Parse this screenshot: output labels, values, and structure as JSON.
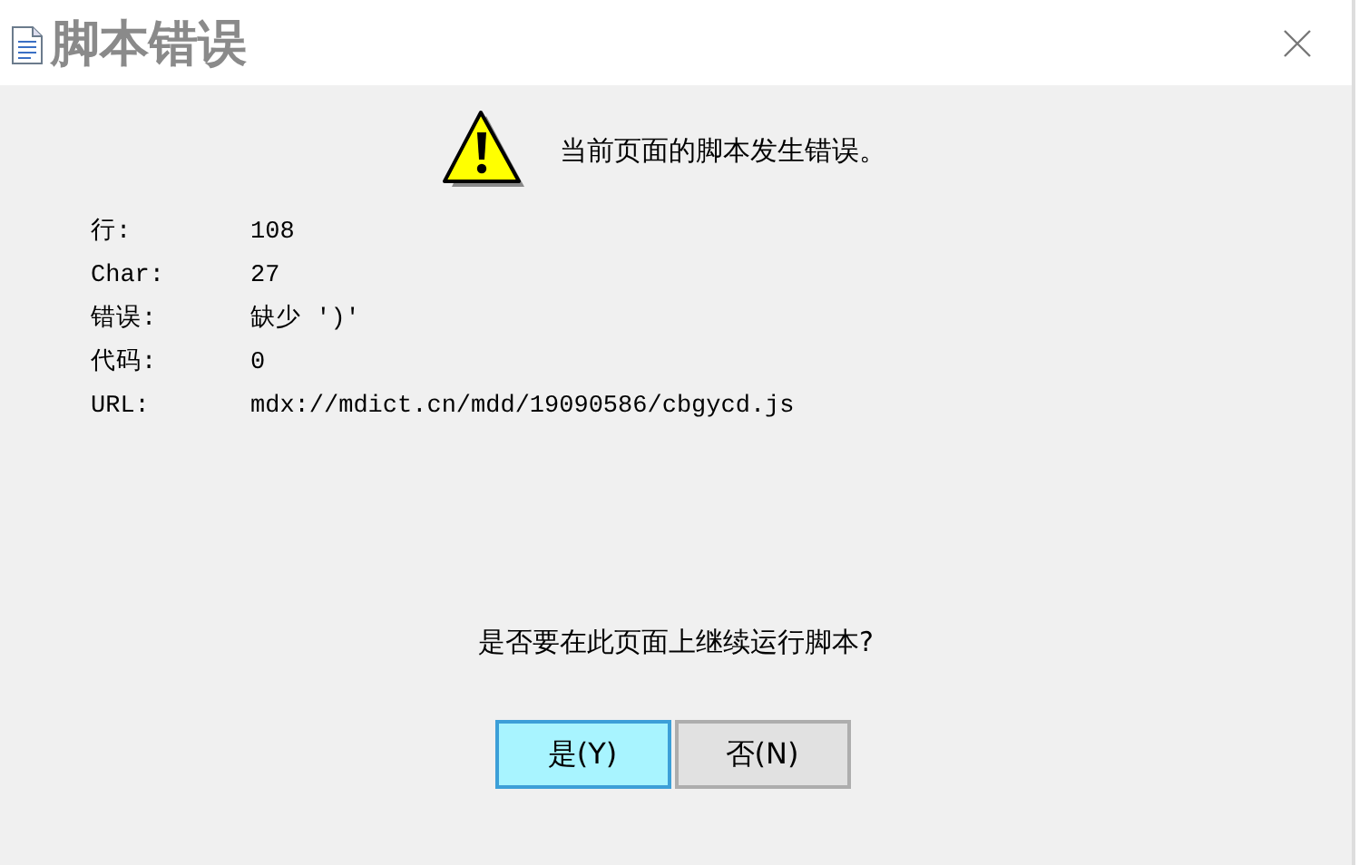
{
  "window": {
    "title": "脚本错误"
  },
  "message": "当前页面的脚本发生错误。",
  "details": [
    {
      "label": "行:",
      "value": "108"
    },
    {
      "label": "Char:",
      "value": "27"
    },
    {
      "label": "错误:",
      "value": "缺少 ')'"
    },
    {
      "label": "代码:",
      "value": "0"
    },
    {
      "label": "URL:",
      "value": "mdx://mdict.cn/mdd/19090586/cbgycd.js"
    }
  ],
  "question": "是否要在此页面上继续运行脚本?",
  "buttons": [
    {
      "label": "是(Y)",
      "selected": true
    },
    {
      "label": "否(N)",
      "selected": false
    }
  ]
}
